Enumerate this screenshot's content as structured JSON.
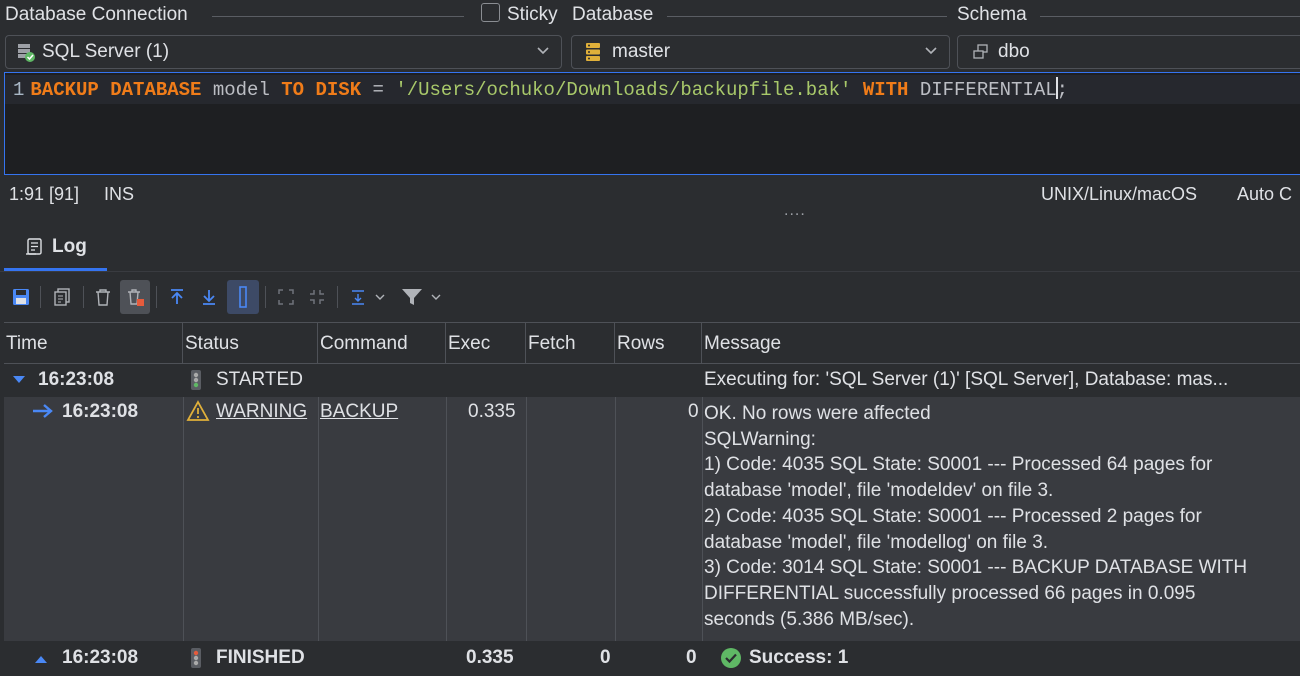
{
  "top": {
    "db_connection_label": "Database Connection",
    "sticky_label": "Sticky",
    "database_label": "Database",
    "schema_label": "Schema"
  },
  "combos": {
    "connection": "SQL Server (1)",
    "database": "master",
    "schema": "dbo"
  },
  "editor": {
    "line_number": "1",
    "tokens": [
      {
        "t": "BACKUP",
        "c": "kw"
      },
      {
        "t": " ",
        "c": "id"
      },
      {
        "t": "DATABASE",
        "c": "kw"
      },
      {
        "t": " model ",
        "c": "id"
      },
      {
        "t": "TO",
        "c": "kw"
      },
      {
        "t": " ",
        "c": "id"
      },
      {
        "t": "DISK",
        "c": "kw"
      },
      {
        "t": " = ",
        "c": "id"
      },
      {
        "t": "'/Users/ochuko/Downloads/backupfile.bak'",
        "c": "str"
      },
      {
        "t": " ",
        "c": "id"
      },
      {
        "t": "WITH",
        "c": "kw"
      },
      {
        "t": " DIFFERENTIAL",
        "c": "id"
      }
    ],
    "after_caret": ";"
  },
  "status": {
    "position": "1:91 [91]",
    "mode": "INS",
    "line_endings": "UNIX/Linux/macOS",
    "auto": "Auto C",
    "dots": "...."
  },
  "log_tab": {
    "label": "Log"
  },
  "columns": [
    "Time",
    "Status",
    "Command",
    "Exec",
    "Fetch",
    "Rows",
    "Message"
  ],
  "rows": [
    {
      "time": "16:23:08",
      "status": "STARTED",
      "command": "",
      "exec": "",
      "fetch": "",
      "rows": "",
      "message": [
        "Executing for: 'SQL Server (1)' [SQL Server], Database: mas..."
      ]
    },
    {
      "time": "16:23:08",
      "status": "WARNING",
      "command": "BACKUP",
      "exec": "0.335",
      "fetch": "",
      "rows": "0",
      "message": [
        "OK. No rows were affected",
        "SQLWarning:",
        "1) Code: 4035 SQL State: S0001 --- Processed 64 pages for",
        "database 'model', file 'modeldev' on file 3.",
        "2) Code: 4035 SQL State: S0001 --- Processed 2 pages for",
        "database 'model', file 'modellog' on file 3.",
        "3) Code: 3014 SQL State: S0001 --- BACKUP DATABASE WITH",
        "DIFFERENTIAL successfully processed 66 pages in 0.095",
        "seconds (5.386 MB/sec)."
      ]
    },
    {
      "time": "16:23:08",
      "status": "FINISHED",
      "command": "",
      "exec": "0.335",
      "fetch": "0",
      "rows": "0",
      "message": [
        "Success: 1"
      ]
    }
  ],
  "colors": {
    "accent": "#3574f0",
    "keyword": "#f07c19",
    "string": "#a8c86a",
    "success": "#5fb865",
    "warning": "#e0b03a"
  }
}
